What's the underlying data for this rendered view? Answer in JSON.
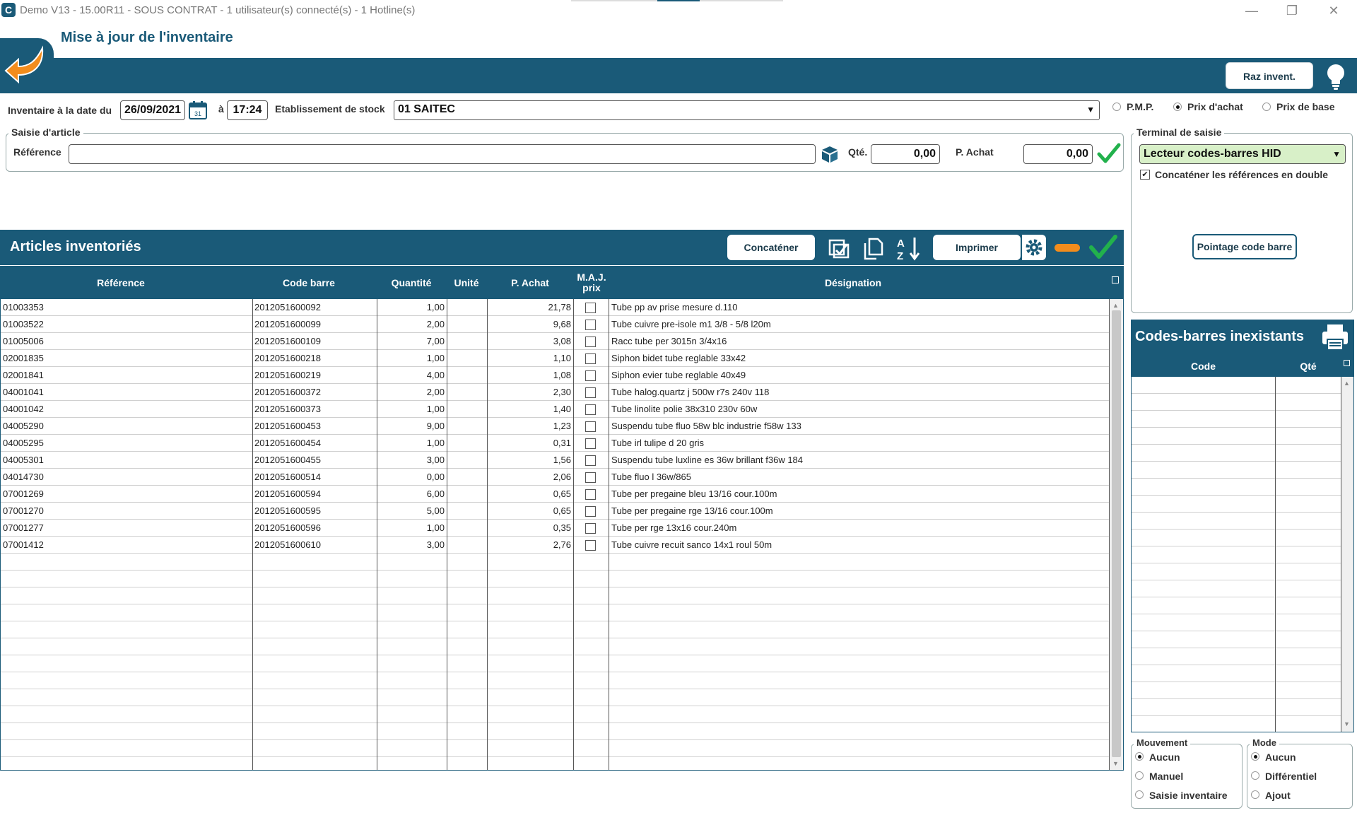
{
  "window": {
    "app_icon_letter": "C",
    "title": "Demo V13 - 15.00R11 - SOUS CONTRAT - 1 utilisateur(s) connecté(s) - 1 Hotline(s)",
    "minimize": "—",
    "restore": "❐",
    "close": "✕"
  },
  "header": {
    "title": "Mise à jour de l'inventaire",
    "raz_button": "Raz invent."
  },
  "inventory": {
    "date_label": "Inventaire à la date du",
    "date_value": "26/09/2021",
    "at_label": "à",
    "time_value": "17:24",
    "establishment_label": "Etablissement de stock",
    "establishment_value": "01 SAITEC",
    "price_options": [
      {
        "label": "P.M.P.",
        "selected": false
      },
      {
        "label": "Prix d'achat",
        "selected": true
      },
      {
        "label": "Prix de base",
        "selected": false
      }
    ]
  },
  "article_entry": {
    "group_title": "Saisie d'article",
    "reference_label": "Référence",
    "reference_value": "",
    "qty_label": "Qté.",
    "qty_value": "0,00",
    "price_label": "P. Achat",
    "price_value": "0,00"
  },
  "terminal": {
    "group_title": "Terminal de saisie",
    "selected": "Lecteur codes-barres HID",
    "concat_label": "Concaténer les références en double",
    "concat_checked": true,
    "pointage_button": "Pointage code barre"
  },
  "articles": {
    "title": "Articles inventoriés",
    "concat_button": "Concaténer",
    "print_button": "Imprimer",
    "columns": [
      "Référence",
      "Code barre",
      "Quantité",
      "Unité",
      "P. Achat",
      "M.A.J. prix",
      "Désignation"
    ],
    "rows": [
      {
        "ref": "01003353",
        "barcode": "2012051600092",
        "qty": "1,00",
        "unit": "",
        "price": "21,78",
        "maj": false,
        "designation": "Tube pp av prise mesure d.110"
      },
      {
        "ref": "01003522",
        "barcode": "2012051600099",
        "qty": "2,00",
        "unit": "",
        "price": "9,68",
        "maj": false,
        "designation": "Tube cuivre pre-isole m1 3/8 - 5/8 l20m"
      },
      {
        "ref": "01005006",
        "barcode": "2012051600109",
        "qty": "7,00",
        "unit": "",
        "price": "3,08",
        "maj": false,
        "designation": "Racc tube per 3015n 3/4x16"
      },
      {
        "ref": "02001835",
        "barcode": "2012051600218",
        "qty": "1,00",
        "unit": "",
        "price": "1,10",
        "maj": false,
        "designation": "Siphon bidet tube reglable 33x42"
      },
      {
        "ref": "02001841",
        "barcode": "2012051600219",
        "qty": "4,00",
        "unit": "",
        "price": "1,08",
        "maj": false,
        "designation": "Siphon evier tube reglable 40x49"
      },
      {
        "ref": "04001041",
        "barcode": "2012051600372",
        "qty": "2,00",
        "unit": "",
        "price": "2,30",
        "maj": false,
        "designation": "Tube halog.quartz j 500w r7s 240v 118"
      },
      {
        "ref": "04001042",
        "barcode": "2012051600373",
        "qty": "1,00",
        "unit": "",
        "price": "1,40",
        "maj": false,
        "designation": "Tube linolite polie 38x310 230v 60w"
      },
      {
        "ref": "04005290",
        "barcode": "2012051600453",
        "qty": "9,00",
        "unit": "",
        "price": "1,23",
        "maj": false,
        "designation": "Suspendu tube fluo 58w blc industrie f58w 133"
      },
      {
        "ref": "04005295",
        "barcode": "2012051600454",
        "qty": "1,00",
        "unit": "",
        "price": "0,31",
        "maj": false,
        "designation": "Tube irl tulipe d 20 gris"
      },
      {
        "ref": "04005301",
        "barcode": "2012051600455",
        "qty": "3,00",
        "unit": "",
        "price": "1,56",
        "maj": false,
        "designation": "Suspendu tube luxline es 36w brillant f36w 184"
      },
      {
        "ref": "04014730",
        "barcode": "2012051600514",
        "qty": "0,00",
        "unit": "",
        "price": "2,06",
        "maj": false,
        "designation": "Tube fluo l 36w/865"
      },
      {
        "ref": "07001269",
        "barcode": "2012051600594",
        "qty": "6,00",
        "unit": "",
        "price": "0,65",
        "maj": false,
        "designation": "Tube per pregaine bleu 13/16 cour.100m"
      },
      {
        "ref": "07001270",
        "barcode": "2012051600595",
        "qty": "5,00",
        "unit": "",
        "price": "0,65",
        "maj": false,
        "designation": "Tube per pregaine rge 13/16 cour.100m"
      },
      {
        "ref": "07001277",
        "barcode": "2012051600596",
        "qty": "1,00",
        "unit": "",
        "price": "0,35",
        "maj": false,
        "designation": "Tube per rge 13x16 cour.240m"
      },
      {
        "ref": "07001412",
        "barcode": "2012051600610",
        "qty": "3,00",
        "unit": "",
        "price": "2,76",
        "maj": false,
        "designation": "Tube cuivre recuit sanco 14x1  roul 50m"
      }
    ]
  },
  "missing_barcodes": {
    "title": "Codes-barres inexistants",
    "columns": [
      "Code",
      "Qté"
    ]
  },
  "mouvement": {
    "title": "Mouvement",
    "options": [
      {
        "label": "Aucun",
        "selected": true
      },
      {
        "label": "Manuel",
        "selected": false
      },
      {
        "label": "Saisie inventaire",
        "selected": false
      }
    ]
  },
  "mode": {
    "title": "Mode",
    "options": [
      {
        "label": "Aucun",
        "selected": true
      },
      {
        "label": "Différentiel",
        "selected": false
      },
      {
        "label": "Ajout",
        "selected": false
      }
    ]
  },
  "colors": {
    "primary": "#1a5a78",
    "accent_orange": "#f28c1c",
    "check_green": "#22b14c",
    "terminal_green": "#d8f0c8"
  }
}
